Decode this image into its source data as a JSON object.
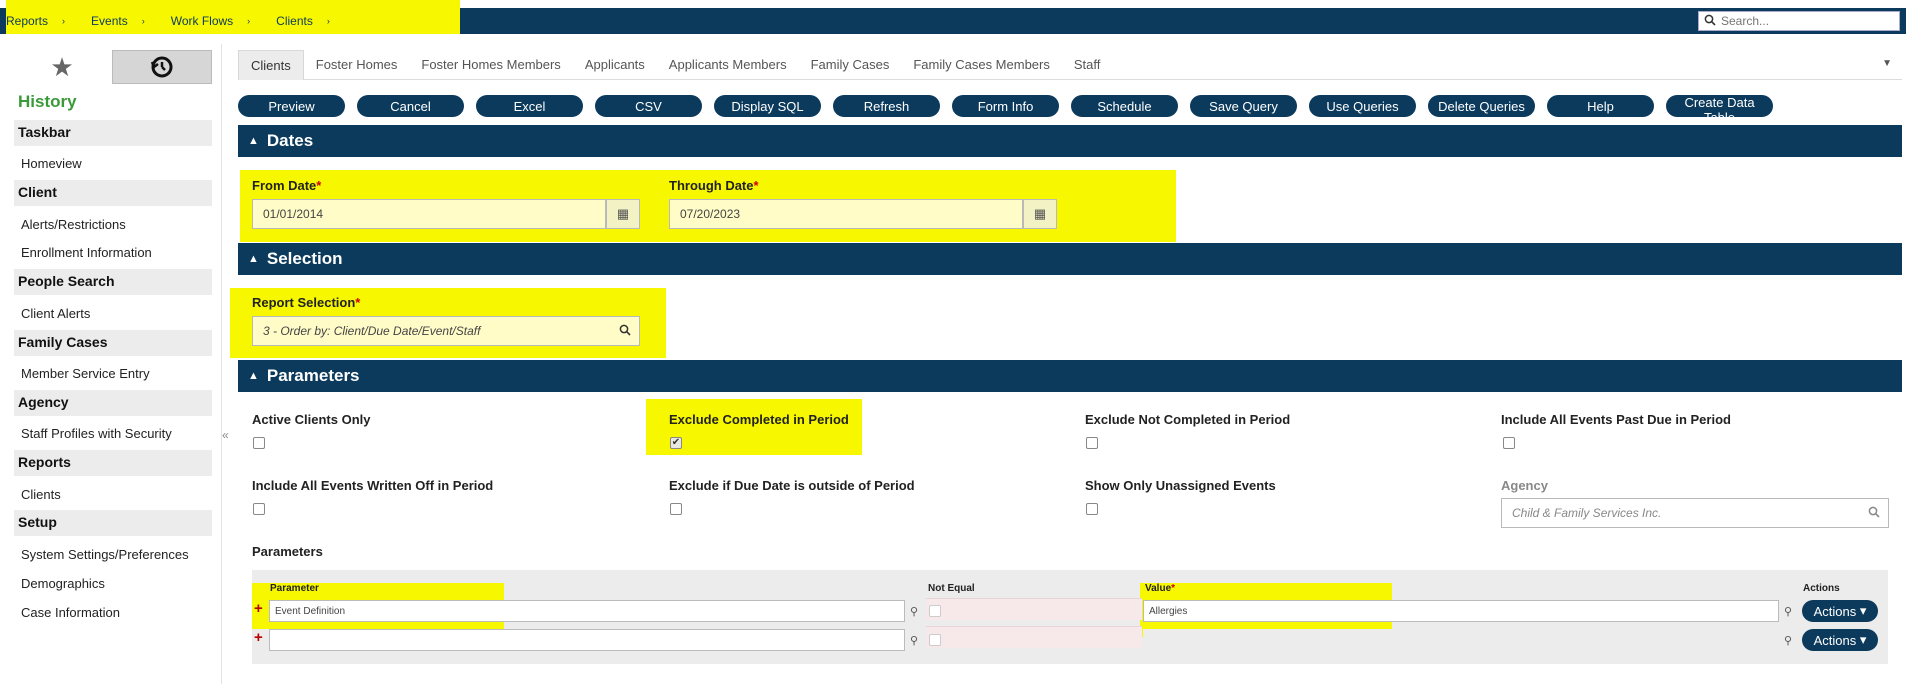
{
  "breadcrumbs": [
    {
      "label": "Reports"
    },
    {
      "label": "Events"
    },
    {
      "label": "Work Flows"
    },
    {
      "label": "Clients"
    }
  ],
  "search": {
    "placeholder": "Search..."
  },
  "sidebar": {
    "history_title": "History",
    "groups": [
      {
        "title": "Taskbar",
        "items": [
          "Homeview"
        ]
      },
      {
        "title": "Client",
        "items": [
          "Alerts/Restrictions",
          "Enrollment Information"
        ]
      },
      {
        "title": "People Search",
        "items": [
          "Client Alerts"
        ]
      },
      {
        "title": "Family Cases",
        "items": [
          "Member Service Entry"
        ]
      },
      {
        "title": "Agency",
        "items": [
          "Staff Profiles with Security"
        ]
      },
      {
        "title": "Reports",
        "items": [
          "Clients"
        ]
      },
      {
        "title": "Setup",
        "items": [
          "System Settings/Preferences",
          "Demographics",
          "Case Information"
        ]
      }
    ]
  },
  "tabs": [
    "Clients",
    "Foster Homes",
    "Foster Homes Members",
    "Applicants",
    "Applicants Members",
    "Family Cases",
    "Family Cases Members",
    "Staff"
  ],
  "toolbar": [
    "Preview",
    "Cancel",
    "Excel",
    "CSV",
    "Display SQL",
    "Refresh",
    "Form Info",
    "Schedule",
    "Save Query",
    "Use Queries",
    "Delete Queries",
    "Help",
    "Create Data Table"
  ],
  "sections": {
    "dates": "Dates",
    "selection": "Selection",
    "parameters": "Parameters"
  },
  "dates": {
    "from_label": "From Date",
    "from_value": "01/01/2014",
    "through_label": "Through Date",
    "through_value": "07/20/2023",
    "required_mark": "*"
  },
  "selection": {
    "label": "Report Selection",
    "value": "3 - Order by: Client/Due Date/Event/Staff"
  },
  "parameters": {
    "checkboxes": [
      {
        "label": "Active Clients Only",
        "checked": false
      },
      {
        "label": "Exclude Completed in Period",
        "checked": true
      },
      {
        "label": "Exclude Not Completed in Period",
        "checked": false
      },
      {
        "label": "Include All Events Past Due in Period",
        "checked": false
      },
      {
        "label": "Include All Events Written Off in Period",
        "checked": false
      },
      {
        "label": "Exclude if Due Date is outside of Period",
        "checked": false
      },
      {
        "label": "Show Only Unassigned Events",
        "checked": false
      }
    ],
    "agency_label": "Agency",
    "agency_placeholder": "Child & Family Services Inc.",
    "grid_title": "Parameters",
    "grid_headers": {
      "parameter": "Parameter",
      "not_equal": "Not Equal",
      "value": "Value",
      "actions": "Actions"
    },
    "rows": [
      {
        "parameter": "Event Definition",
        "value": "Allergies",
        "actions": "Actions"
      },
      {
        "parameter": "",
        "value": "",
        "actions": "Actions"
      }
    ]
  },
  "colors": {
    "navy": "#0b3a5c",
    "highlight": "#f7f700",
    "history_green": "#3a9a3a"
  }
}
